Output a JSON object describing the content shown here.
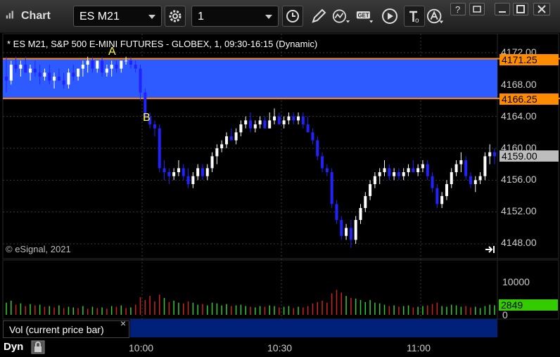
{
  "window": {
    "title": "Chart"
  },
  "toolbar": {
    "symbol_value": "ES M21",
    "interval_value": "1",
    "icons": [
      "settings-gear-icon",
      "clock-icon",
      "pencil-draw-icon",
      "indicator-icon",
      "get-data-icon",
      "play-icon",
      "text-tool-icon",
      "alert-icon"
    ]
  },
  "chart": {
    "info_line": "* ES M21, S&P 500 E-MINI FUTURES - GLOBEX, 1, 09:30-16:15 (Dynamic)",
    "copyright": "© eSignal, 2021",
    "price_axis": [
      "4172.00",
      "4168.00",
      "4164.00",
      "4160.00",
      "4156.00",
      "4152.00",
      "4148.00"
    ],
    "zone_top_tag": "4171.25",
    "zone_bottom_tag": "4166.25",
    "last_price_tag": "4159.00",
    "marker_a": "A",
    "marker_b": "B",
    "volume_axis": [
      "10000",
      "0"
    ],
    "volume_tag": "2849",
    "volume_tab": "Vol (current price bar)",
    "close_icon_glyph": "×",
    "time_axis": [
      "10:00",
      "10:30",
      "11:00"
    ],
    "status_label": "Dyn",
    "colors": {
      "up": "#ffffff",
      "down": "#2222ff",
      "zone": "#2e5bff",
      "zone_line": "#ff8c00",
      "vol_up": "#33cc33",
      "vol_down": "#cc2222",
      "vol_tag": "#33cc00"
    }
  },
  "chart_data": {
    "type": "candlestick",
    "ylim": [
      4146,
      4174
    ],
    "zone": [
      4166.25,
      4171.25
    ],
    "ohlc": [
      [
        4169.0,
        4171.5,
        4167.0,
        4168.5
      ],
      [
        4168.5,
        4171.0,
        4168.0,
        4170.5
      ],
      [
        4170.5,
        4171.5,
        4169.5,
        4170.0
      ],
      [
        4170.0,
        4171.0,
        4169.0,
        4170.5
      ],
      [
        4170.5,
        4171.5,
        4169.5,
        4169.5
      ],
      [
        4169.5,
        4170.5,
        4168.5,
        4170.0
      ],
      [
        4170.0,
        4171.0,
        4169.0,
        4169.5
      ],
      [
        4169.5,
        4170.5,
        4168.0,
        4169.0
      ],
      [
        4169.0,
        4170.0,
        4168.5,
        4169.5
      ],
      [
        4169.5,
        4170.5,
        4168.0,
        4168.5
      ],
      [
        4168.5,
        4169.5,
        4167.5,
        4169.0
      ],
      [
        4169.0,
        4170.0,
        4168.5,
        4168.5
      ],
      [
        4168.5,
        4169.5,
        4167.5,
        4168.0
      ],
      [
        4168.0,
        4170.0,
        4167.5,
        4169.5
      ],
      [
        4169.5,
        4170.5,
        4168.5,
        4169.0
      ],
      [
        4169.0,
        4170.0,
        4168.5,
        4170.0
      ],
      [
        4170.0,
        4171.0,
        4169.0,
        4170.5
      ],
      [
        4170.5,
        4171.5,
        4169.5,
        4171.0
      ],
      [
        4171.0,
        4171.5,
        4169.5,
        4170.0
      ],
      [
        4170.0,
        4171.0,
        4169.5,
        4171.0
      ],
      [
        4171.0,
        4171.5,
        4169.0,
        4169.5
      ],
      [
        4169.5,
        4170.5,
        4169.0,
        4170.0
      ],
      [
        4170.0,
        4171.0,
        4169.0,
        4170.5
      ],
      [
        4170.5,
        4171.0,
        4169.5,
        4170.0
      ],
      [
        4170.0,
        4171.0,
        4169.5,
        4171.0
      ],
      [
        4171.0,
        4171.5,
        4170.5,
        4171.0
      ],
      [
        4171.0,
        4171.5,
        4170.0,
        4170.5
      ],
      [
        4170.5,
        4171.0,
        4169.5,
        4170.0
      ],
      [
        4170.0,
        4170.5,
        4166.0,
        4167.0
      ],
      [
        4167.0,
        4167.5,
        4163.5,
        4164.0
      ],
      [
        4164.0,
        4164.5,
        4162.5,
        4163.0
      ],
      [
        4163.0,
        4163.5,
        4161.5,
        4162.5
      ],
      [
        4162.5,
        4163.0,
        4157.0,
        4157.5
      ],
      [
        4157.5,
        4158.5,
        4156.0,
        4157.0
      ],
      [
        4157.0,
        4157.5,
        4155.5,
        4156.5
      ],
      [
        4156.5,
        4157.5,
        4156.0,
        4157.0
      ],
      [
        4157.0,
        4158.5,
        4156.5,
        4157.5
      ],
      [
        4157.5,
        4158.0,
        4156.0,
        4156.5
      ],
      [
        4156.5,
        4157.5,
        4155.0,
        4155.5
      ],
      [
        4155.5,
        4157.0,
        4155.0,
        4156.5
      ],
      [
        4156.5,
        4158.0,
        4156.0,
        4157.5
      ],
      [
        4157.5,
        4158.0,
        4156.0,
        4156.5
      ],
      [
        4156.5,
        4158.0,
        4156.0,
        4157.5
      ],
      [
        4157.5,
        4159.5,
        4157.0,
        4159.0
      ],
      [
        4159.0,
        4160.5,
        4158.0,
        4160.0
      ],
      [
        4160.0,
        4161.0,
        4159.5,
        4160.5
      ],
      [
        4160.5,
        4162.0,
        4160.0,
        4161.5
      ],
      [
        4161.5,
        4162.5,
        4161.0,
        4161.0
      ],
      [
        4161.0,
        4162.5,
        4160.5,
        4162.0
      ],
      [
        4162.0,
        4163.5,
        4161.5,
        4163.0
      ],
      [
        4163.0,
        4164.0,
        4162.5,
        4163.5
      ],
      [
        4163.5,
        4164.5,
        4162.0,
        4162.5
      ],
      [
        4162.5,
        4163.5,
        4162.0,
        4163.0
      ],
      [
        4163.0,
        4164.0,
        4162.5,
        4163.5
      ],
      [
        4163.5,
        4164.0,
        4162.5,
        4162.5
      ],
      [
        4162.5,
        4164.5,
        4162.5,
        4163.5
      ],
      [
        4163.5,
        4165.0,
        4163.0,
        4164.0
      ],
      [
        4164.0,
        4164.5,
        4163.0,
        4163.0
      ],
      [
        4163.0,
        4164.0,
        4162.5,
        4163.5
      ],
      [
        4163.5,
        4164.5,
        4163.0,
        4164.0
      ],
      [
        4164.0,
        4164.5,
        4163.0,
        4163.5
      ],
      [
        4163.5,
        4164.5,
        4163.0,
        4164.0
      ],
      [
        4164.0,
        4164.5,
        4162.5,
        4163.0
      ],
      [
        4163.0,
        4164.0,
        4162.0,
        4162.0
      ],
      [
        4162.0,
        4162.5,
        4160.5,
        4161.0
      ],
      [
        4161.0,
        4161.5,
        4158.5,
        4159.0
      ],
      [
        4159.0,
        4159.5,
        4157.0,
        4157.5
      ],
      [
        4157.5,
        4158.0,
        4156.5,
        4157.0
      ],
      [
        4157.0,
        4157.5,
        4152.5,
        4153.0
      ],
      [
        4153.0,
        4153.5,
        4150.5,
        4151.0
      ],
      [
        4151.0,
        4151.5,
        4148.5,
        4149.0
      ],
      [
        4149.0,
        4150.5,
        4148.5,
        4150.0
      ],
      [
        4150.0,
        4151.0,
        4147.5,
        4148.5
      ],
      [
        4148.5,
        4151.5,
        4148.0,
        4151.0
      ],
      [
        4151.0,
        4153.0,
        4150.5,
        4152.5
      ],
      [
        4152.5,
        4154.5,
        4152.0,
        4154.0
      ],
      [
        4154.0,
        4156.0,
        4153.5,
        4155.5
      ],
      [
        4155.5,
        4157.0,
        4155.0,
        4156.5
      ],
      [
        4156.5,
        4157.5,
        4155.5,
        4157.0
      ],
      [
        4157.0,
        4158.5,
        4156.5,
        4157.5
      ],
      [
        4157.5,
        4158.0,
        4156.0,
        4156.5
      ],
      [
        4156.5,
        4157.5,
        4156.0,
        4157.0
      ],
      [
        4157.0,
        4157.5,
        4156.0,
        4156.5
      ],
      [
        4156.5,
        4157.5,
        4156.0,
        4157.0
      ],
      [
        4157.0,
        4158.0,
        4156.5,
        4157.5
      ],
      [
        4157.5,
        4158.5,
        4157.0,
        4157.0
      ],
      [
        4157.0,
        4158.0,
        4156.5,
        4157.5
      ],
      [
        4157.5,
        4158.5,
        4157.0,
        4158.0
      ],
      [
        4158.0,
        4158.5,
        4156.0,
        4156.5
      ],
      [
        4156.5,
        4157.0,
        4154.5,
        4155.0
      ],
      [
        4155.0,
        4155.5,
        4152.5,
        4153.0
      ],
      [
        4153.0,
        4154.5,
        4152.5,
        4154.0
      ],
      [
        4154.0,
        4156.0,
        4153.5,
        4155.5
      ],
      [
        4155.5,
        4157.5,
        4155.0,
        4157.0
      ],
      [
        4157.0,
        4158.5,
        4156.5,
        4158.0
      ],
      [
        4158.0,
        4159.5,
        4157.0,
        4158.5
      ],
      [
        4158.5,
        4159.0,
        4156.0,
        4156.5
      ],
      [
        4156.5,
        4157.0,
        4155.0,
        4155.5
      ],
      [
        4155.5,
        4156.5,
        4154.5,
        4156.0
      ],
      [
        4156.0,
        4157.0,
        4155.5,
        4156.5
      ],
      [
        4156.5,
        4159.5,
        4156.0,
        4159.0
      ],
      [
        4159.0,
        4160.5,
        4158.0,
        4159.5
      ],
      [
        4159.5,
        4160.0,
        4158.0,
        4159.0
      ]
    ],
    "volume": [
      [
        3600,
        1
      ],
      [
        4200,
        1
      ],
      [
        3000,
        0
      ],
      [
        3400,
        1
      ],
      [
        2600,
        0
      ],
      [
        3200,
        1
      ],
      [
        2800,
        0
      ],
      [
        3000,
        1
      ],
      [
        2400,
        0
      ],
      [
        2600,
        1
      ],
      [
        2200,
        0
      ],
      [
        2800,
        1
      ],
      [
        2000,
        0
      ],
      [
        2400,
        1
      ],
      [
        2200,
        1
      ],
      [
        2000,
        0
      ],
      [
        2600,
        1
      ],
      [
        1800,
        0
      ],
      [
        2400,
        1
      ],
      [
        2000,
        0
      ],
      [
        2200,
        1
      ],
      [
        1800,
        0
      ],
      [
        2600,
        1
      ],
      [
        2400,
        0
      ],
      [
        2800,
        1
      ],
      [
        2000,
        0
      ],
      [
        2200,
        1
      ],
      [
        3000,
        0
      ],
      [
        5200,
        0
      ],
      [
        4400,
        0
      ],
      [
        5600,
        0
      ],
      [
        4000,
        0
      ],
      [
        6000,
        0
      ],
      [
        5000,
        1
      ],
      [
        3800,
        0
      ],
      [
        4200,
        1
      ],
      [
        3600,
        1
      ],
      [
        3400,
        0
      ],
      [
        4000,
        0
      ],
      [
        3600,
        1
      ],
      [
        3000,
        1
      ],
      [
        3200,
        0
      ],
      [
        2800,
        1
      ],
      [
        3600,
        1
      ],
      [
        3400,
        1
      ],
      [
        2800,
        1
      ],
      [
        3200,
        1
      ],
      [
        2600,
        0
      ],
      [
        2800,
        1
      ],
      [
        3000,
        1
      ],
      [
        2600,
        1
      ],
      [
        2400,
        0
      ],
      [
        2200,
        1
      ],
      [
        2600,
        1
      ],
      [
        2400,
        0
      ],
      [
        2800,
        1
      ],
      [
        2600,
        1
      ],
      [
        2200,
        0
      ],
      [
        2400,
        1
      ],
      [
        2600,
        1
      ],
      [
        2000,
        0
      ],
      [
        2400,
        1
      ],
      [
        2200,
        0
      ],
      [
        2600,
        0
      ],
      [
        3400,
        0
      ],
      [
        3800,
        0
      ],
      [
        4200,
        0
      ],
      [
        3600,
        0
      ],
      [
        6400,
        0
      ],
      [
        7400,
        0
      ],
      [
        6600,
        0
      ],
      [
        5600,
        1
      ],
      [
        5000,
        0
      ],
      [
        4800,
        1
      ],
      [
        4400,
        1
      ],
      [
        3800,
        1
      ],
      [
        4400,
        1
      ],
      [
        3600,
        1
      ],
      [
        3400,
        1
      ],
      [
        3000,
        1
      ],
      [
        2600,
        0
      ],
      [
        2800,
        1
      ],
      [
        2400,
        0
      ],
      [
        2600,
        1
      ],
      [
        2800,
        1
      ],
      [
        2200,
        0
      ],
      [
        2400,
        1
      ],
      [
        2600,
        1
      ],
      [
        2800,
        0
      ],
      [
        3200,
        0
      ],
      [
        3600,
        0
      ],
      [
        2600,
        1
      ],
      [
        2400,
        1
      ],
      [
        3000,
        1
      ],
      [
        2800,
        1
      ],
      [
        2400,
        1
      ],
      [
        2600,
        0
      ],
      [
        2200,
        0
      ],
      [
        2400,
        1
      ],
      [
        2000,
        1
      ],
      [
        2600,
        1
      ],
      [
        3000,
        1
      ],
      [
        2849,
        1
      ]
    ]
  }
}
